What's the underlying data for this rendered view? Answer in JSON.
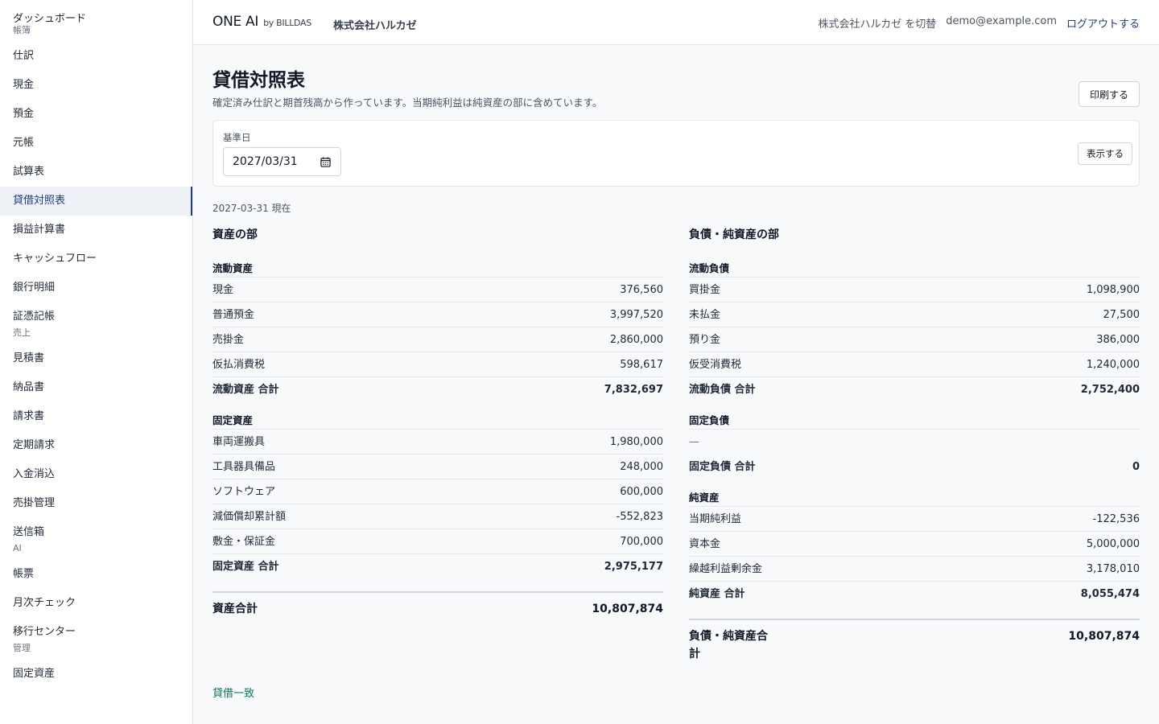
{
  "sidebar": {
    "top_item": "ダッシュボード",
    "sections": [
      {
        "label": "帳簿",
        "items": [
          "仕訳",
          "現金",
          "預金",
          "元帳",
          "試算表",
          "貸借対照表",
          "損益計算書",
          "キャッシュフロー",
          "銀行明細",
          "証憑記帳"
        ]
      },
      {
        "label": "売上",
        "items": [
          "見積書",
          "納品書",
          "請求書",
          "定期請求",
          "入金消込",
          "売掛管理",
          "送信箱"
        ]
      },
      {
        "label": "AI",
        "items": [
          "帳票",
          "月次チェック",
          "移行センター"
        ]
      },
      {
        "label": "管理",
        "items": [
          "固定資産"
        ]
      }
    ],
    "active_item": "貸借対照表"
  },
  "header": {
    "brand": "ONE AI",
    "brand_by": "by BILLDAS",
    "company": "株式会社ハルカゼ",
    "switch_label": "株式会社ハルカゼ を切替",
    "email": "demo@example.com",
    "logout_label": "ログアウトする"
  },
  "page": {
    "title": "貸借対照表",
    "description": "確定済み仕訳と期首残高から作っています。当期純利益は純資産の部に含めています。",
    "print_label": "印刷する",
    "filter": {
      "label": "基準日",
      "date_value": "2027/03/31",
      "show_label": "表示する"
    },
    "as_of": "2027-03-31 現在",
    "balanced_label": "貸借一致"
  },
  "assets": {
    "title": "資産の部",
    "groups": [
      {
        "title": "流動資産",
        "rows": [
          {
            "label": "現金",
            "value": "376,560"
          },
          {
            "label": "普通預金",
            "value": "3,997,520"
          },
          {
            "label": "売掛金",
            "value": "2,860,000"
          },
          {
            "label": "仮払消費税",
            "value": "598,617"
          }
        ],
        "total_label": "流動資産 合計",
        "total_value": "7,832,697"
      },
      {
        "title": "固定資産",
        "rows": [
          {
            "label": "車両運搬具",
            "value": "1,980,000"
          },
          {
            "label": "工具器具備品",
            "value": "248,000"
          },
          {
            "label": "ソフトウェア",
            "value": "600,000"
          },
          {
            "label": "減価償却累計額",
            "value": "-552,823"
          },
          {
            "label": "敷金・保証金",
            "value": "700,000"
          }
        ],
        "total_label": "固定資産 合計",
        "total_value": "2,975,177"
      }
    ],
    "grand_label": "資産合計",
    "grand_value": "10,807,874"
  },
  "liabilities": {
    "title": "負債・純資産の部",
    "groups": [
      {
        "title": "流動負債",
        "rows": [
          {
            "label": "買掛金",
            "value": "1,098,900"
          },
          {
            "label": "未払金",
            "value": "27,500"
          },
          {
            "label": "預り金",
            "value": "386,000"
          },
          {
            "label": "仮受消費税",
            "value": "1,240,000"
          }
        ],
        "total_label": "流動負債 合計",
        "total_value": "2,752,400"
      },
      {
        "title": "固定負債",
        "rows": [
          {
            "label": "—",
            "value": ""
          }
        ],
        "total_label": "固定負債 合計",
        "total_value": "0"
      },
      {
        "title": "純資産",
        "rows": [
          {
            "label": "当期純利益",
            "value": "-122,536"
          },
          {
            "label": "資本金",
            "value": "5,000,000"
          },
          {
            "label": "繰越利益剰余金",
            "value": "3,178,010"
          }
        ],
        "total_label": "純資産 合計",
        "total_value": "8,055,474"
      }
    ],
    "grand_label": "負債・純資産合計",
    "grand_value": "10,807,874"
  }
}
